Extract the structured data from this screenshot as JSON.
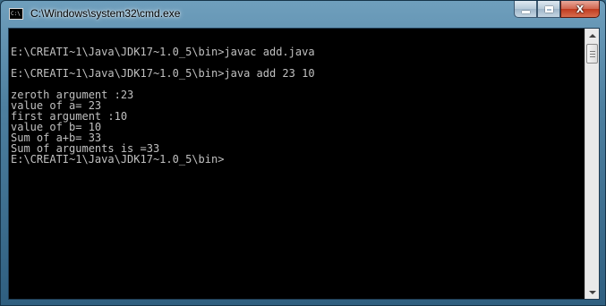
{
  "window": {
    "title": "C:\\Windows\\system32\\cmd.exe",
    "icon": "cmd-icon",
    "icon_text": "C:\\"
  },
  "controls": {
    "minimize": "minimize-icon",
    "maximize": "maximize-icon",
    "close_label": "X"
  },
  "console": {
    "lines": [
      "",
      "E:\\CREATI~1\\Java\\JDK17~1.0_5\\bin>javac add.java",
      "",
      "E:\\CREATI~1\\Java\\JDK17~1.0_5\\bin>java add 23 10",
      "",
      "zeroth argument :23",
      "value of a= 23",
      "first argument :10",
      "value of b= 10",
      "Sum of a+b= 33",
      "Sum of arguments is =33",
      "E:\\CREATI~1\\Java\\JDK17~1.0_5\\bin>"
    ]
  },
  "colors": {
    "console_bg": "#000000",
    "console_text": "#c0c0c0",
    "close_button": "#c8432a"
  }
}
